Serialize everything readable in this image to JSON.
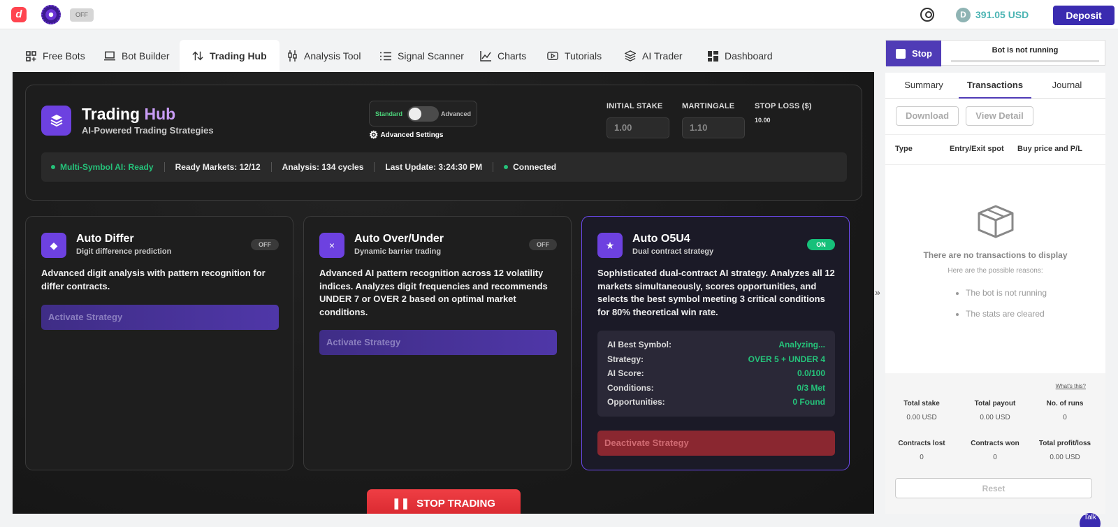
{
  "topbar": {
    "toggle_label": "OFF",
    "balance": "391.05 USD",
    "deposit_label": "Deposit"
  },
  "tabs": [
    {
      "label": "Free Bots",
      "icon": "grid-plus-icon"
    },
    {
      "label": "Bot Builder",
      "icon": "bot-builder-icon"
    },
    {
      "label": "Trading Hub",
      "icon": "arrows-updown-icon"
    },
    {
      "label": "Analysis Tool",
      "icon": "candles-icon"
    },
    {
      "label": "Signal Scanner",
      "icon": "list-icon"
    },
    {
      "label": "Charts",
      "icon": "line-chart-icon"
    },
    {
      "label": "Tutorials",
      "icon": "play-icon"
    },
    {
      "label": "AI Trader",
      "icon": "layers-icon"
    },
    {
      "label": "Dashboard",
      "icon": "dashboard-icon"
    }
  ],
  "hub": {
    "title_main": "Trading",
    "title_accent": "Hub",
    "subtitle": "AI-Powered Trading Strategies",
    "mode_standard": "Standard",
    "mode_advanced": "Advanced",
    "advanced_settings": "Advanced Settings",
    "initial_stake_label": "INITIAL STAKE",
    "initial_stake_value": "1.00",
    "martingale_label": "MARTINGALE",
    "martingale_value": "1.10",
    "stop_loss_label": "STOP LOSS ($)",
    "stop_loss_value": "10.00",
    "status": {
      "ai": "Multi-Symbol AI: Ready",
      "markets": "Ready Markets: 12/12",
      "analysis": "Analysis: 134 cycles",
      "update": "Last Update: 3:24:30 PM",
      "connection": "Connected"
    }
  },
  "cards": [
    {
      "title": "Auto Differ",
      "subtitle": "Digit difference prediction",
      "badge": "OFF",
      "desc": "Advanced digit analysis with pattern recognition for differ contracts.",
      "button": "Activate Strategy"
    },
    {
      "title": "Auto Over/Under",
      "subtitle": "Dynamic barrier trading",
      "badge": "OFF",
      "desc": "Advanced AI pattern recognition across 12 volatility indices. Analyzes digit frequencies and recommends UNDER 7 or OVER 2 based on optimal market conditions.",
      "button": "Activate Strategy"
    },
    {
      "title": "Auto O5U4",
      "subtitle": "Dual contract strategy",
      "badge": "ON",
      "desc": "Sophisticated dual-contract AI strategy. Analyzes all 12 markets simultaneously, scores opportunities, and selects the best symbol meeting 3 critical conditions for 80% theoretical win rate.",
      "button": "Deactivate Strategy",
      "details": [
        {
          "label": "AI Best Symbol:",
          "value": "Analyzing..."
        },
        {
          "label": "Strategy:",
          "value": "OVER 5 + UNDER 4"
        },
        {
          "label": "AI Score:",
          "value": "0.0/100"
        },
        {
          "label": "Conditions:",
          "value": "0/3 Met"
        },
        {
          "label": "Opportunities:",
          "value": "0 Found"
        }
      ]
    }
  ],
  "stop_trading": "STOP TRADING",
  "sidebar": {
    "stop_label": "Stop",
    "run_status": "Bot is not running",
    "tabs": [
      "Summary",
      "Transactions",
      "Journal"
    ],
    "download": "Download",
    "view_detail": "View Detail",
    "columns": [
      "Type",
      "Entry/Exit spot",
      "Buy price and P/L"
    ],
    "empty_title": "There are no transactions to display",
    "empty_sub": "Here are the possible reasons:",
    "reasons": [
      "The bot is not running",
      "The stats are cleared"
    ],
    "whats_this": "What's this?",
    "stats": [
      {
        "label": "Total stake",
        "value": "0.00 USD"
      },
      {
        "label": "Total payout",
        "value": "0.00 USD"
      },
      {
        "label": "No. of runs",
        "value": "0"
      },
      {
        "label": "Contracts lost",
        "value": "0"
      },
      {
        "label": "Contracts won",
        "value": "0"
      },
      {
        "label": "Total profit/loss",
        "value": "0.00 USD"
      }
    ],
    "reset": "Reset"
  },
  "help_label": "Talk"
}
